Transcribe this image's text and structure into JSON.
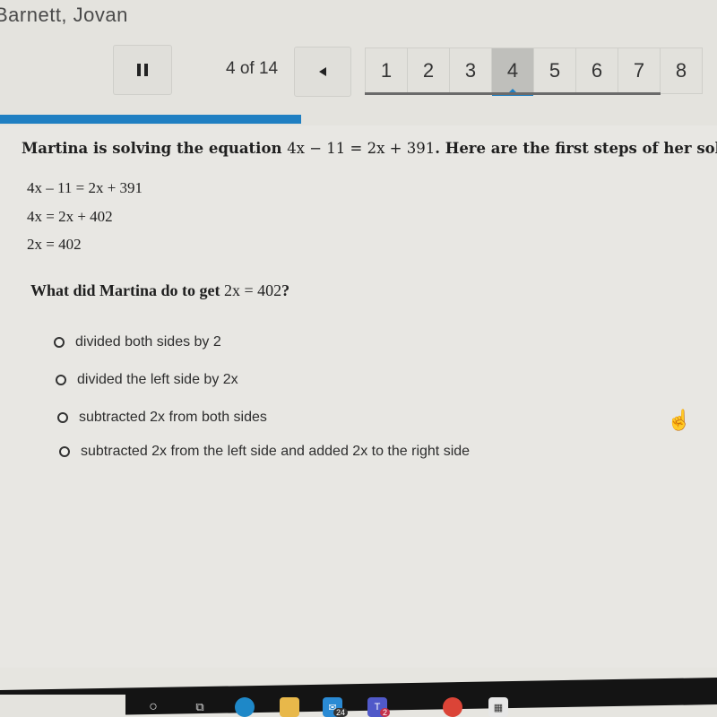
{
  "header": {
    "student_name": "Barnett, Jovan",
    "counter": "4 of 14",
    "progress_fraction": 0.42
  },
  "question_nav": {
    "items": [
      "1",
      "2",
      "3",
      "4",
      "5",
      "6",
      "7",
      "8"
    ],
    "active": "4"
  },
  "question": {
    "prompt_lead": "Martina is solving the equation ",
    "prompt_equation": "4x − 11 = 2x + 391",
    "prompt_tail": ". Here are the first steps of her solution.",
    "steps": [
      "4x – 11 = 2x + 391",
      "4x = 2x + 402",
      "2x = 402"
    ],
    "ask_lead": "What did Martina do to get ",
    "ask_equation": "2x = 402",
    "ask_tail": "?",
    "options": [
      "divided both sides by 2",
      "divided the left side by 2x",
      "subtracted 2x from both sides",
      "subtracted 2x from the left side and added 2x to the right side"
    ]
  },
  "taskbar": {
    "icons": [
      "search",
      "task-view",
      "edge",
      "file-explorer",
      "mail",
      "teams",
      "chrome",
      "store"
    ],
    "mail_badge": "24",
    "teams_badge": "2"
  },
  "colors": {
    "accent": "#1f7fc2"
  }
}
